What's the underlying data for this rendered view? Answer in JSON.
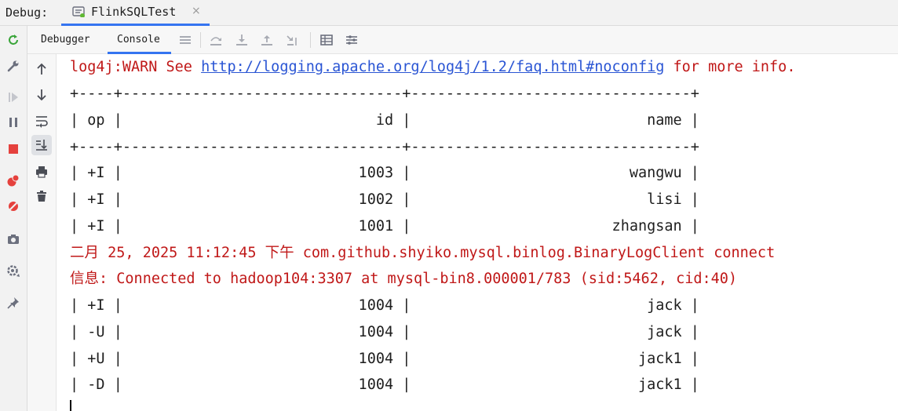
{
  "topbar": {
    "debug_label": "Debug:",
    "run_tab": {
      "label": "FlinkSQLTest",
      "close": "×"
    }
  },
  "tabs": [
    {
      "label": "Debugger",
      "active": false
    },
    {
      "label": "Console",
      "active": true
    }
  ],
  "console": {
    "warn": {
      "prefix": "log4j:WARN See ",
      "link": "http://logging.apache.org/log4j/1.2/faq.html#noconfig",
      "suffix": " for more info."
    },
    "separator": "+----+--------------------------------+--------------------------------+",
    "header": "| op |                             id |                           name |",
    "rows_before": [
      "| +I |                           1003 |                         wangwu |",
      "| +I |                           1002 |                           lisi |",
      "| +I |                           1001 |                       zhangsan |"
    ],
    "log1": "二月 25, 2025 11:12:45 下午 com.github.shyiko.mysql.binlog.BinaryLogClient connect",
    "log2": "信息: Connected to hadoop104:3307 at mysql-bin8.000001/783 (sid:5462, cid:40)",
    "rows_after": [
      "| +I |                           1004 |                           jack |",
      "| -U |                           1004 |                           jack |",
      "| +U |                           1004 |                          jack1 |",
      "| -D |                           1004 |                          jack1 |"
    ]
  },
  "colors": {
    "error_text": "#c01818",
    "link": "#2a55d4",
    "accent": "#3574f0"
  },
  "icons": {
    "left_toolbar": [
      "rerun-icon",
      "wrench-icon",
      "resume-icon",
      "pause-icon",
      "stop-icon",
      "breakpoints-icon",
      "mute-breakpoints-icon",
      "camera-icon",
      "settings-icon",
      "pin-icon"
    ],
    "tabs_toolbar": [
      "menu-icon",
      "step-over-icon",
      "step-into-icon",
      "step-out-icon",
      "run-to-cursor-icon",
      "table-icon",
      "threads-icon"
    ],
    "side_toolbar": [
      "arrow-up-icon",
      "arrow-down-icon",
      "soft-wrap-icon",
      "scroll-to-end-icon",
      "print-icon",
      "trash-icon"
    ]
  }
}
